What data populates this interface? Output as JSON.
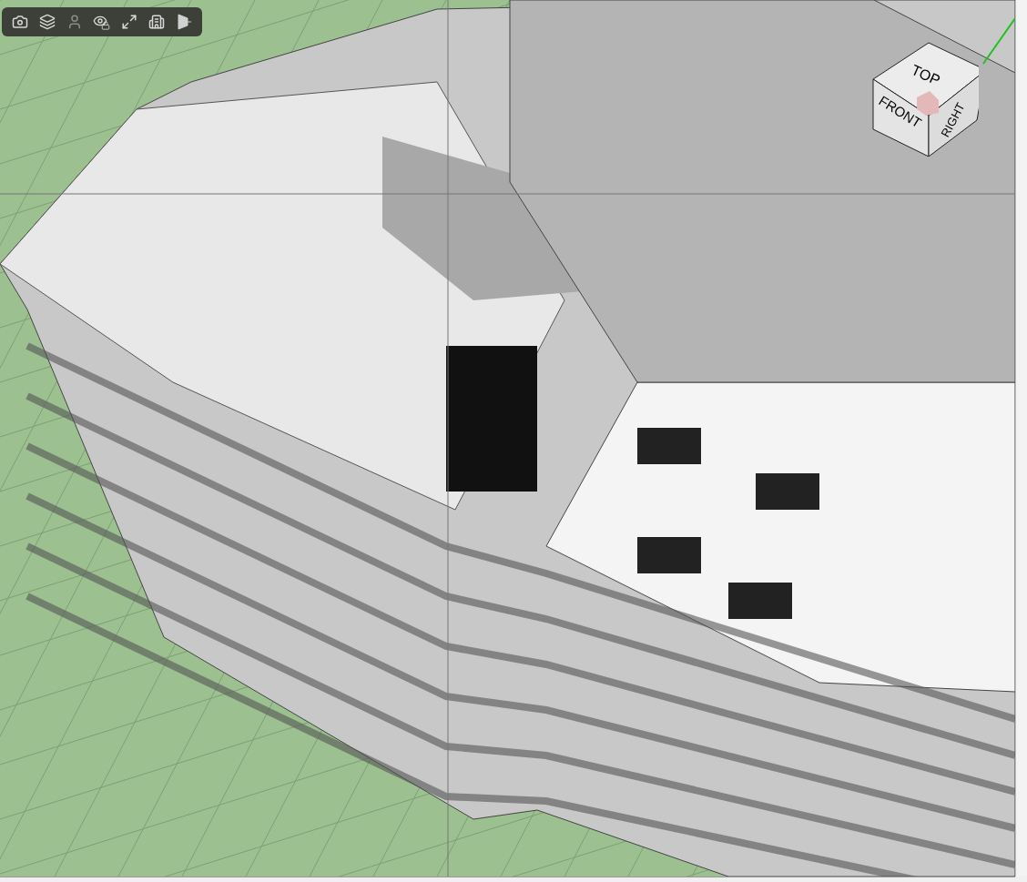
{
  "toolbar": {
    "buttons": [
      {
        "kind": "camera"
      },
      {
        "kind": "layers"
      },
      {
        "kind": "person"
      },
      {
        "kind": "eye-lock"
      },
      {
        "kind": "fit"
      },
      {
        "kind": "floors"
      },
      {
        "kind": "section"
      }
    ]
  },
  "view_cube": {
    "top": "TOP",
    "front": "FRONT",
    "right": "RIGHT"
  }
}
